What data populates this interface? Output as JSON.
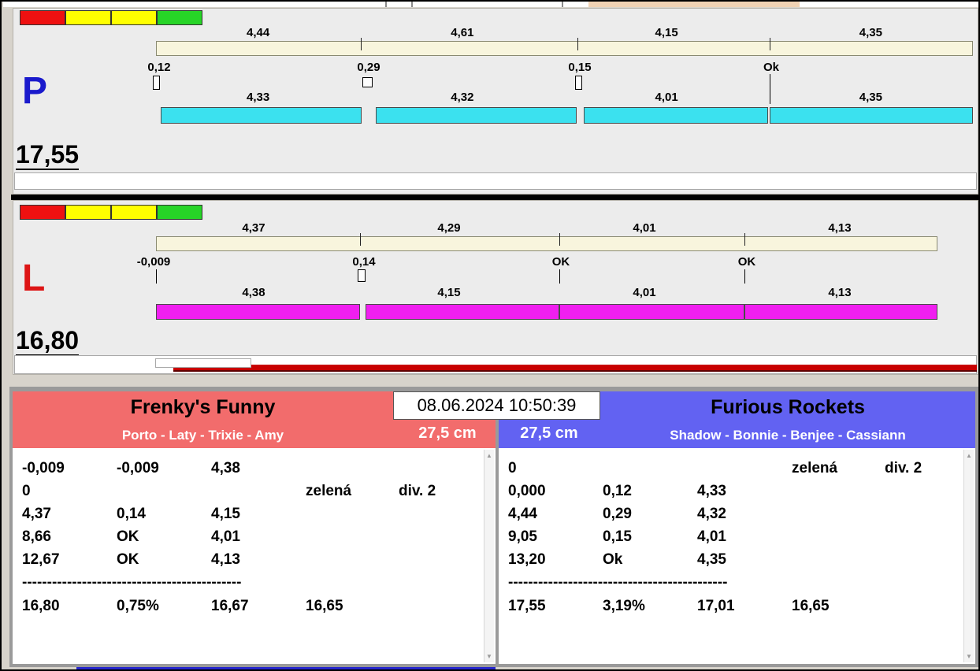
{
  "timestamp": "08.06.2024 10:50:39",
  "lane_p": {
    "label": "P",
    "total": "17,55",
    "segments_top": [
      "4,44",
      "4,61",
      "4,15",
      "4,35"
    ],
    "splits": [
      "0,12",
      "0,29",
      "0,15",
      "Ok"
    ],
    "segments_bottom": [
      "4,33",
      "4,32",
      "4,01",
      "4,35"
    ]
  },
  "lane_l": {
    "label": "L",
    "total": "16,80",
    "segments_top": [
      "4,37",
      "4,29",
      "4,01",
      "4,13"
    ],
    "splits": [
      "-0,009",
      "0,14",
      "OK",
      "OK"
    ],
    "segments_bottom": [
      "4,38",
      "4,15",
      "4,01",
      "4,13"
    ]
  },
  "team_left": {
    "name": "Frenky's Funny",
    "dogs": "Porto - Laty - Trixie - Amy",
    "height": "27,5 cm",
    "rows": [
      [
        "-0,009",
        "-0,009",
        "4,38",
        "",
        ""
      ],
      [
        "0",
        "",
        "",
        "zelená",
        "div. 2"
      ],
      [
        "4,37",
        "0,14",
        "4,15",
        "",
        ""
      ],
      [
        "8,66",
        "OK",
        "4,01",
        "",
        ""
      ],
      [
        "12,67",
        "OK",
        "4,13",
        "",
        ""
      ]
    ],
    "separator": "--------------------------------------------",
    "total_row": [
      "16,80",
      "0,75%",
      "16,67",
      "16,65"
    ]
  },
  "team_right": {
    "name": "Furious Rockets",
    "dogs": "Shadow - Bonnie - Benjee - Cassiann",
    "height": "27,5 cm",
    "rows": [
      [
        "0",
        "",
        "",
        "zelená",
        "div. 2"
      ],
      [
        "0,000",
        "0,12",
        "4,33",
        "",
        ""
      ],
      [
        "4,44",
        "0,29",
        "4,32",
        "",
        ""
      ],
      [
        "9,05",
        "0,15",
        "4,01",
        "",
        ""
      ],
      [
        "13,20",
        "Ok",
        "4,35",
        "",
        ""
      ]
    ],
    "separator": "--------------------------------------------",
    "total_row": [
      "17,55",
      "3,19%",
      "17,01",
      "16,65"
    ]
  },
  "icons": {
    "scroll_up": "▲",
    "scroll_down": "▼"
  },
  "colors": {
    "status_red": "#ee1111",
    "status_yellow": "#ffff00",
    "status_green": "#27d427",
    "lane_p_bar": "#3be1ef",
    "lane_l_bar": "#f01ff0",
    "team_left_header": "#f26c6c",
    "team_right_header": "#6262f2",
    "progress_bar": "#c80000"
  }
}
